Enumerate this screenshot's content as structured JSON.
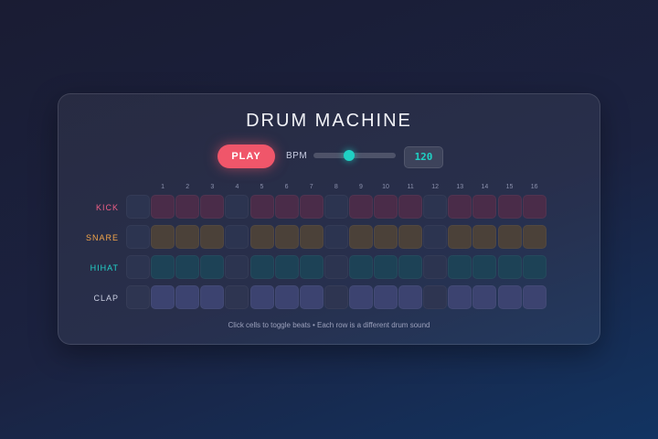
{
  "title": "DRUM MACHINE",
  "controls": {
    "play_label": "PLAY",
    "bpm_label": "BPM",
    "bpm_value": "120",
    "bpm_slider_fraction": 0.43
  },
  "step_numbers": [
    "",
    "1",
    "2",
    "3",
    "4",
    "5",
    "6",
    "7",
    "8",
    "9",
    "10",
    "11",
    "12",
    "13",
    "14",
    "15",
    "16"
  ],
  "rows": [
    {
      "name": "KICK",
      "color": "#ef5f86",
      "on": "#4a2c49",
      "off": "#2c3450",
      "steps": [
        0,
        1,
        1,
        1,
        0,
        1,
        1,
        1,
        0,
        1,
        1,
        1,
        0,
        1,
        1,
        1,
        1
      ]
    },
    {
      "name": "SNARE",
      "color": "#f2a44a",
      "on": "#4b4139",
      "off": "#2c3450",
      "steps": [
        0,
        1,
        1,
        1,
        0,
        1,
        1,
        1,
        0,
        1,
        1,
        1,
        0,
        1,
        1,
        1,
        1
      ]
    },
    {
      "name": "HIHAT",
      "color": "#22d3c9",
      "on": "#1d4256",
      "off": "#2c3450",
      "steps": [
        0,
        1,
        1,
        1,
        0,
        1,
        1,
        1,
        0,
        1,
        1,
        1,
        0,
        1,
        1,
        1,
        1
      ]
    },
    {
      "name": "CLAP",
      "color": "#c9cde0",
      "on": "#3c4370",
      "off": "#2e3551",
      "steps": [
        0,
        1,
        1,
        1,
        0,
        1,
        1,
        1,
        0,
        1,
        1,
        1,
        0,
        1,
        1,
        1,
        1
      ]
    }
  ],
  "footer": "Click cells to toggle beats • Each row is a different drum sound"
}
